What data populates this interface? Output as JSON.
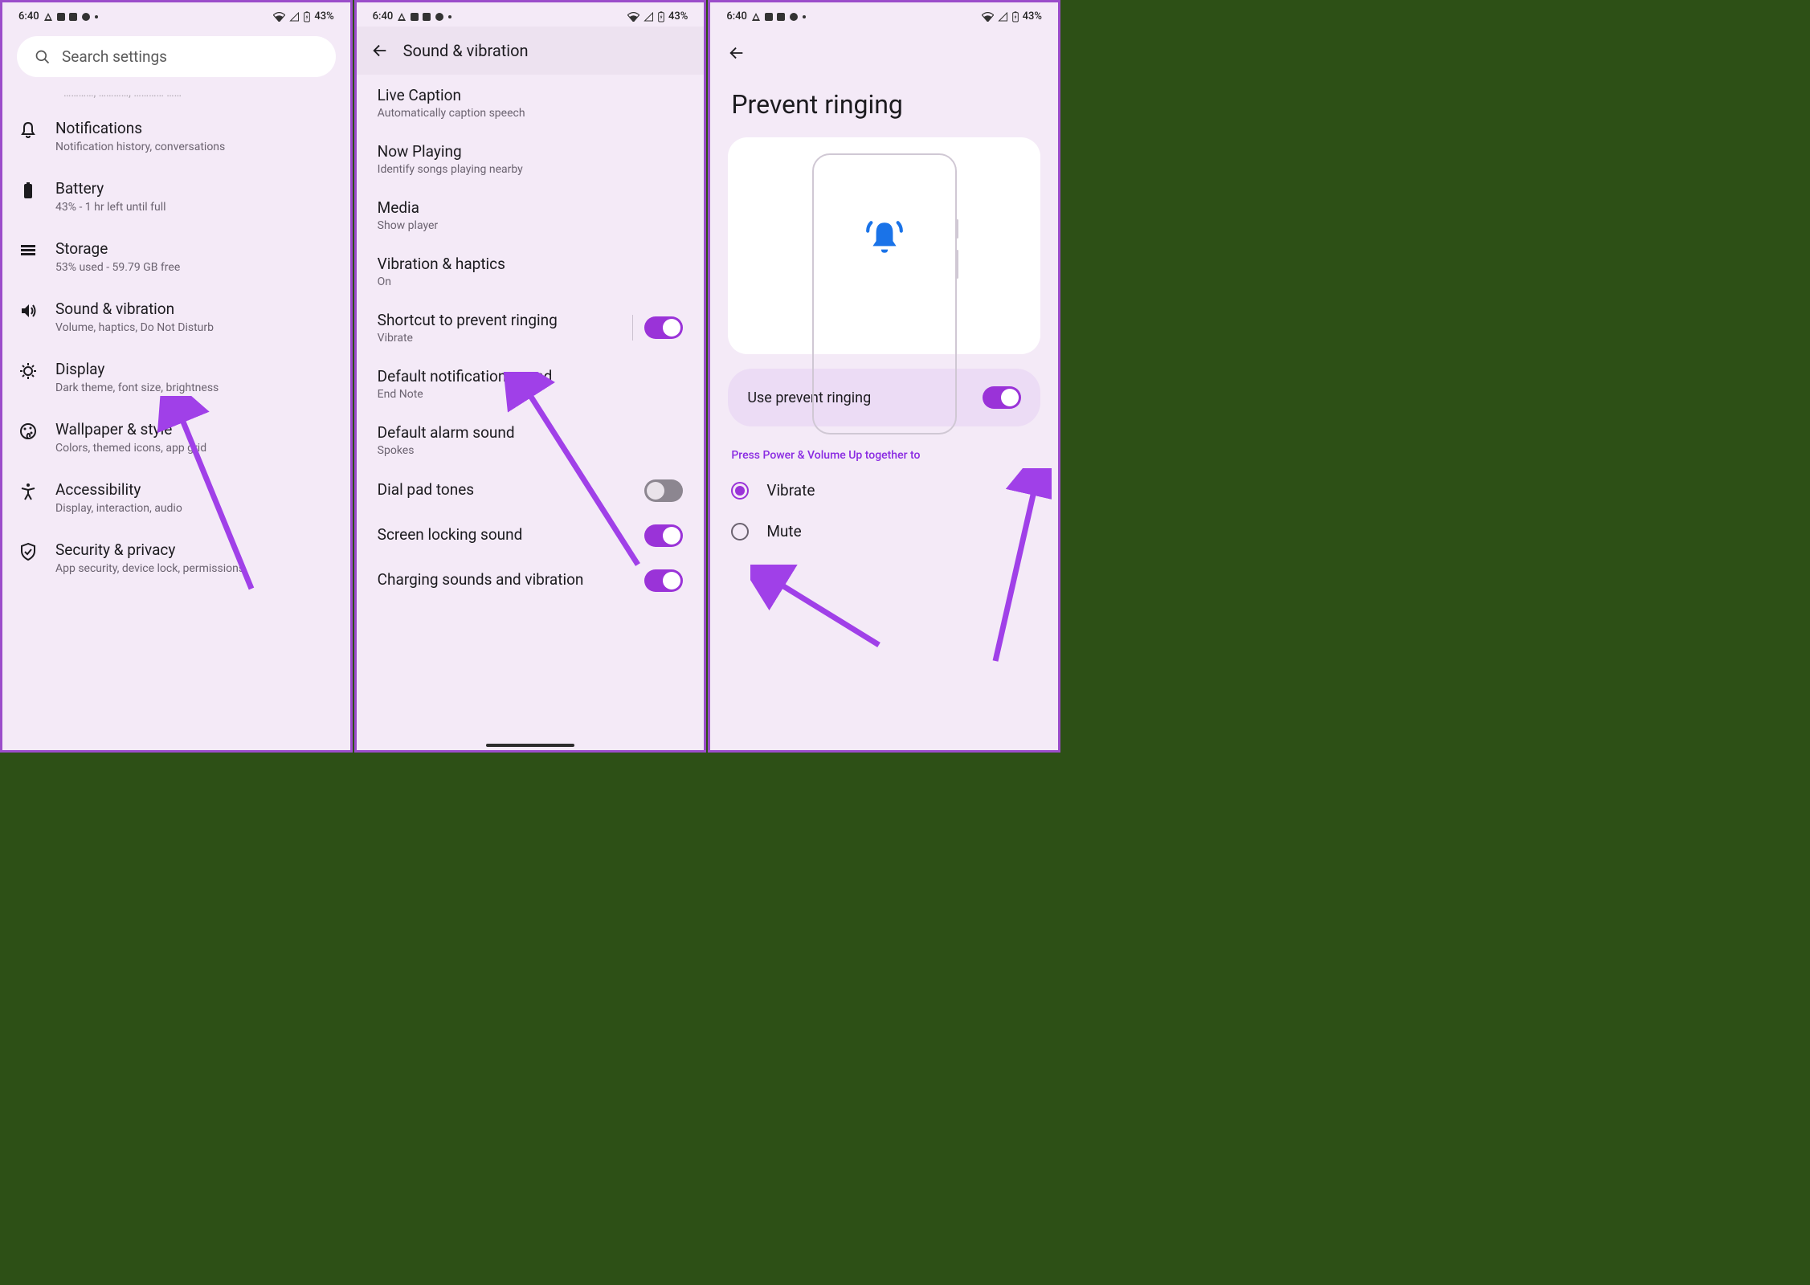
{
  "status": {
    "time": "6:40",
    "battery": "43%",
    "battery_icon": "⚡"
  },
  "s1": {
    "search_placeholder": "Search settings",
    "fade": "",
    "items": [
      {
        "icon": "bell",
        "title": "Notifications",
        "sub": "Notification history, conversations"
      },
      {
        "icon": "battery",
        "title": "Battery",
        "sub": "43% - 1 hr left until full"
      },
      {
        "icon": "storage",
        "title": "Storage",
        "sub": "53% used - 59.79 GB free"
      },
      {
        "icon": "sound",
        "title": "Sound & vibration",
        "sub": "Volume, haptics, Do Not Disturb"
      },
      {
        "icon": "display",
        "title": "Display",
        "sub": "Dark theme, font size, brightness"
      },
      {
        "icon": "wallpaper",
        "title": "Wallpaper & style",
        "sub": "Colors, themed icons, app grid"
      },
      {
        "icon": "accessibility",
        "title": "Accessibility",
        "sub": "Display, interaction, audio"
      },
      {
        "icon": "security",
        "title": "Security & privacy",
        "sub": "App security, device lock, permissions"
      }
    ]
  },
  "s2": {
    "title": "Sound & vibration",
    "rows": [
      {
        "title": "Live Caption",
        "sub": "Automatically caption speech",
        "toggle": null
      },
      {
        "title": "Now Playing",
        "sub": "Identify songs playing nearby",
        "toggle": null
      },
      {
        "title": "Media",
        "sub": "Show player",
        "toggle": null
      },
      {
        "title": "Vibration & haptics",
        "sub": "On",
        "toggle": null
      },
      {
        "title": "Shortcut to prevent ringing",
        "sub": "Vibrate",
        "toggle": "on",
        "divider": true
      },
      {
        "title": "Default notification sound",
        "sub": "End Note",
        "toggle": null
      },
      {
        "title": "Default alarm sound",
        "sub": "Spokes",
        "toggle": null
      },
      {
        "title": "Dial pad tones",
        "sub": "",
        "toggle": "off"
      },
      {
        "title": "Screen locking sound",
        "sub": "",
        "toggle": "on"
      },
      {
        "title": "Charging sounds and vibration",
        "sub": "",
        "toggle": "on"
      }
    ]
  },
  "s3": {
    "title": "Prevent ringing",
    "toggle_label": "Use prevent ringing",
    "toggle_state": "on",
    "section": "Press Power & Volume Up together to",
    "options": [
      {
        "label": "Vibrate",
        "selected": true
      },
      {
        "label": "Mute",
        "selected": false
      }
    ]
  }
}
